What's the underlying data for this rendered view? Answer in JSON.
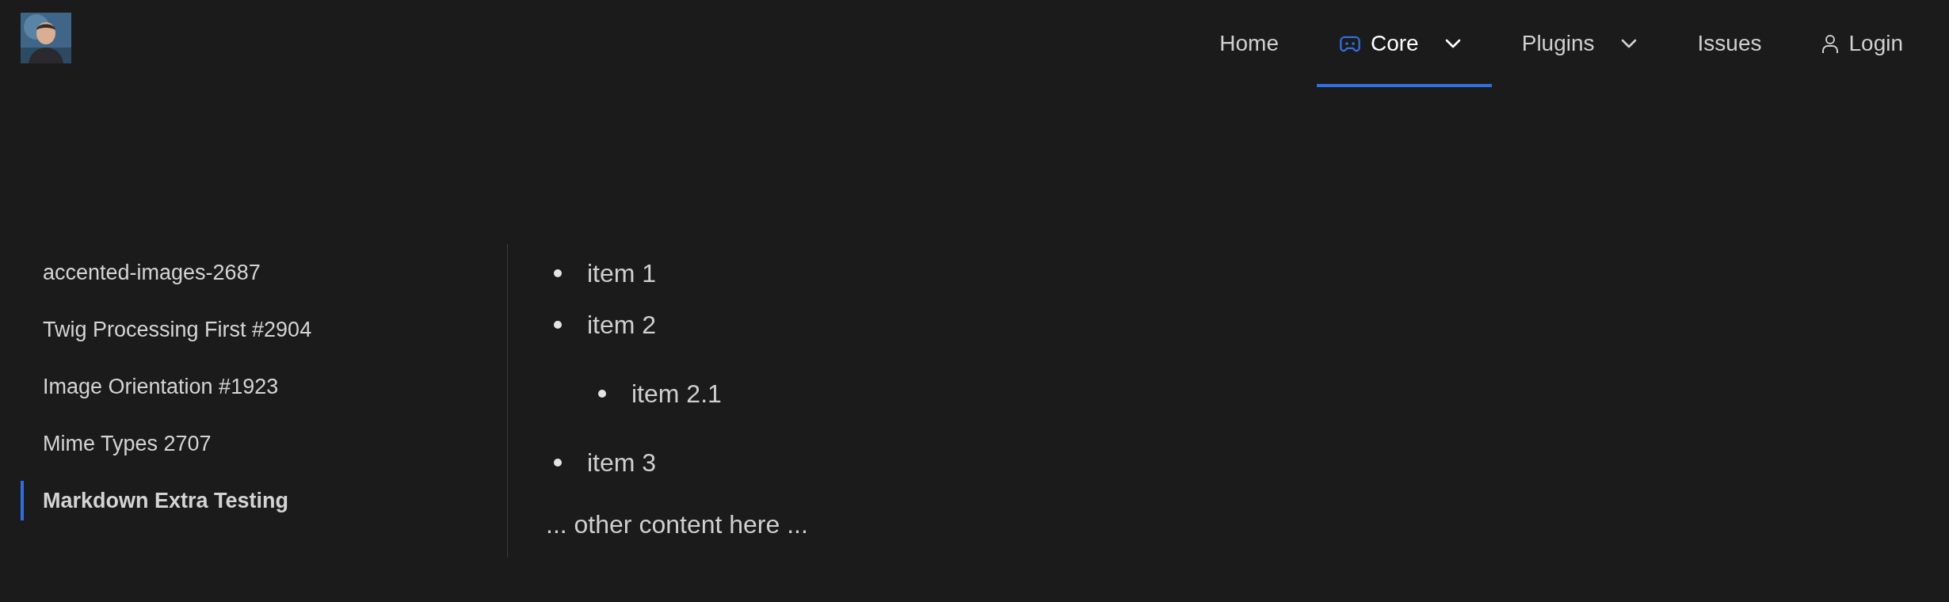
{
  "header": {
    "nav": [
      {
        "label": "Home",
        "kind": "link",
        "selected": false
      },
      {
        "label": "Core",
        "kind": "menu_with_icon",
        "selected": true
      },
      {
        "label": "Plugins",
        "kind": "menu",
        "selected": false
      },
      {
        "label": "Issues",
        "kind": "link",
        "selected": false
      },
      {
        "label": "Login",
        "kind": "account",
        "selected": false
      }
    ]
  },
  "sidebar": {
    "items": [
      {
        "label": "accented-images-2687",
        "selected": false
      },
      {
        "label": "Twig Processing First #2904",
        "selected": false
      },
      {
        "label": "Image Orientation #1923",
        "selected": false
      },
      {
        "label": "Mime Types 2707",
        "selected": false
      },
      {
        "label": "Markdown Extra Testing",
        "selected": true
      }
    ]
  },
  "content": {
    "list": [
      {
        "text": "item 1"
      },
      {
        "text": "item 2",
        "children": [
          {
            "text": "item 2.1"
          }
        ]
      },
      {
        "text": "item 3"
      }
    ],
    "paragraph": "... other content here ..."
  }
}
